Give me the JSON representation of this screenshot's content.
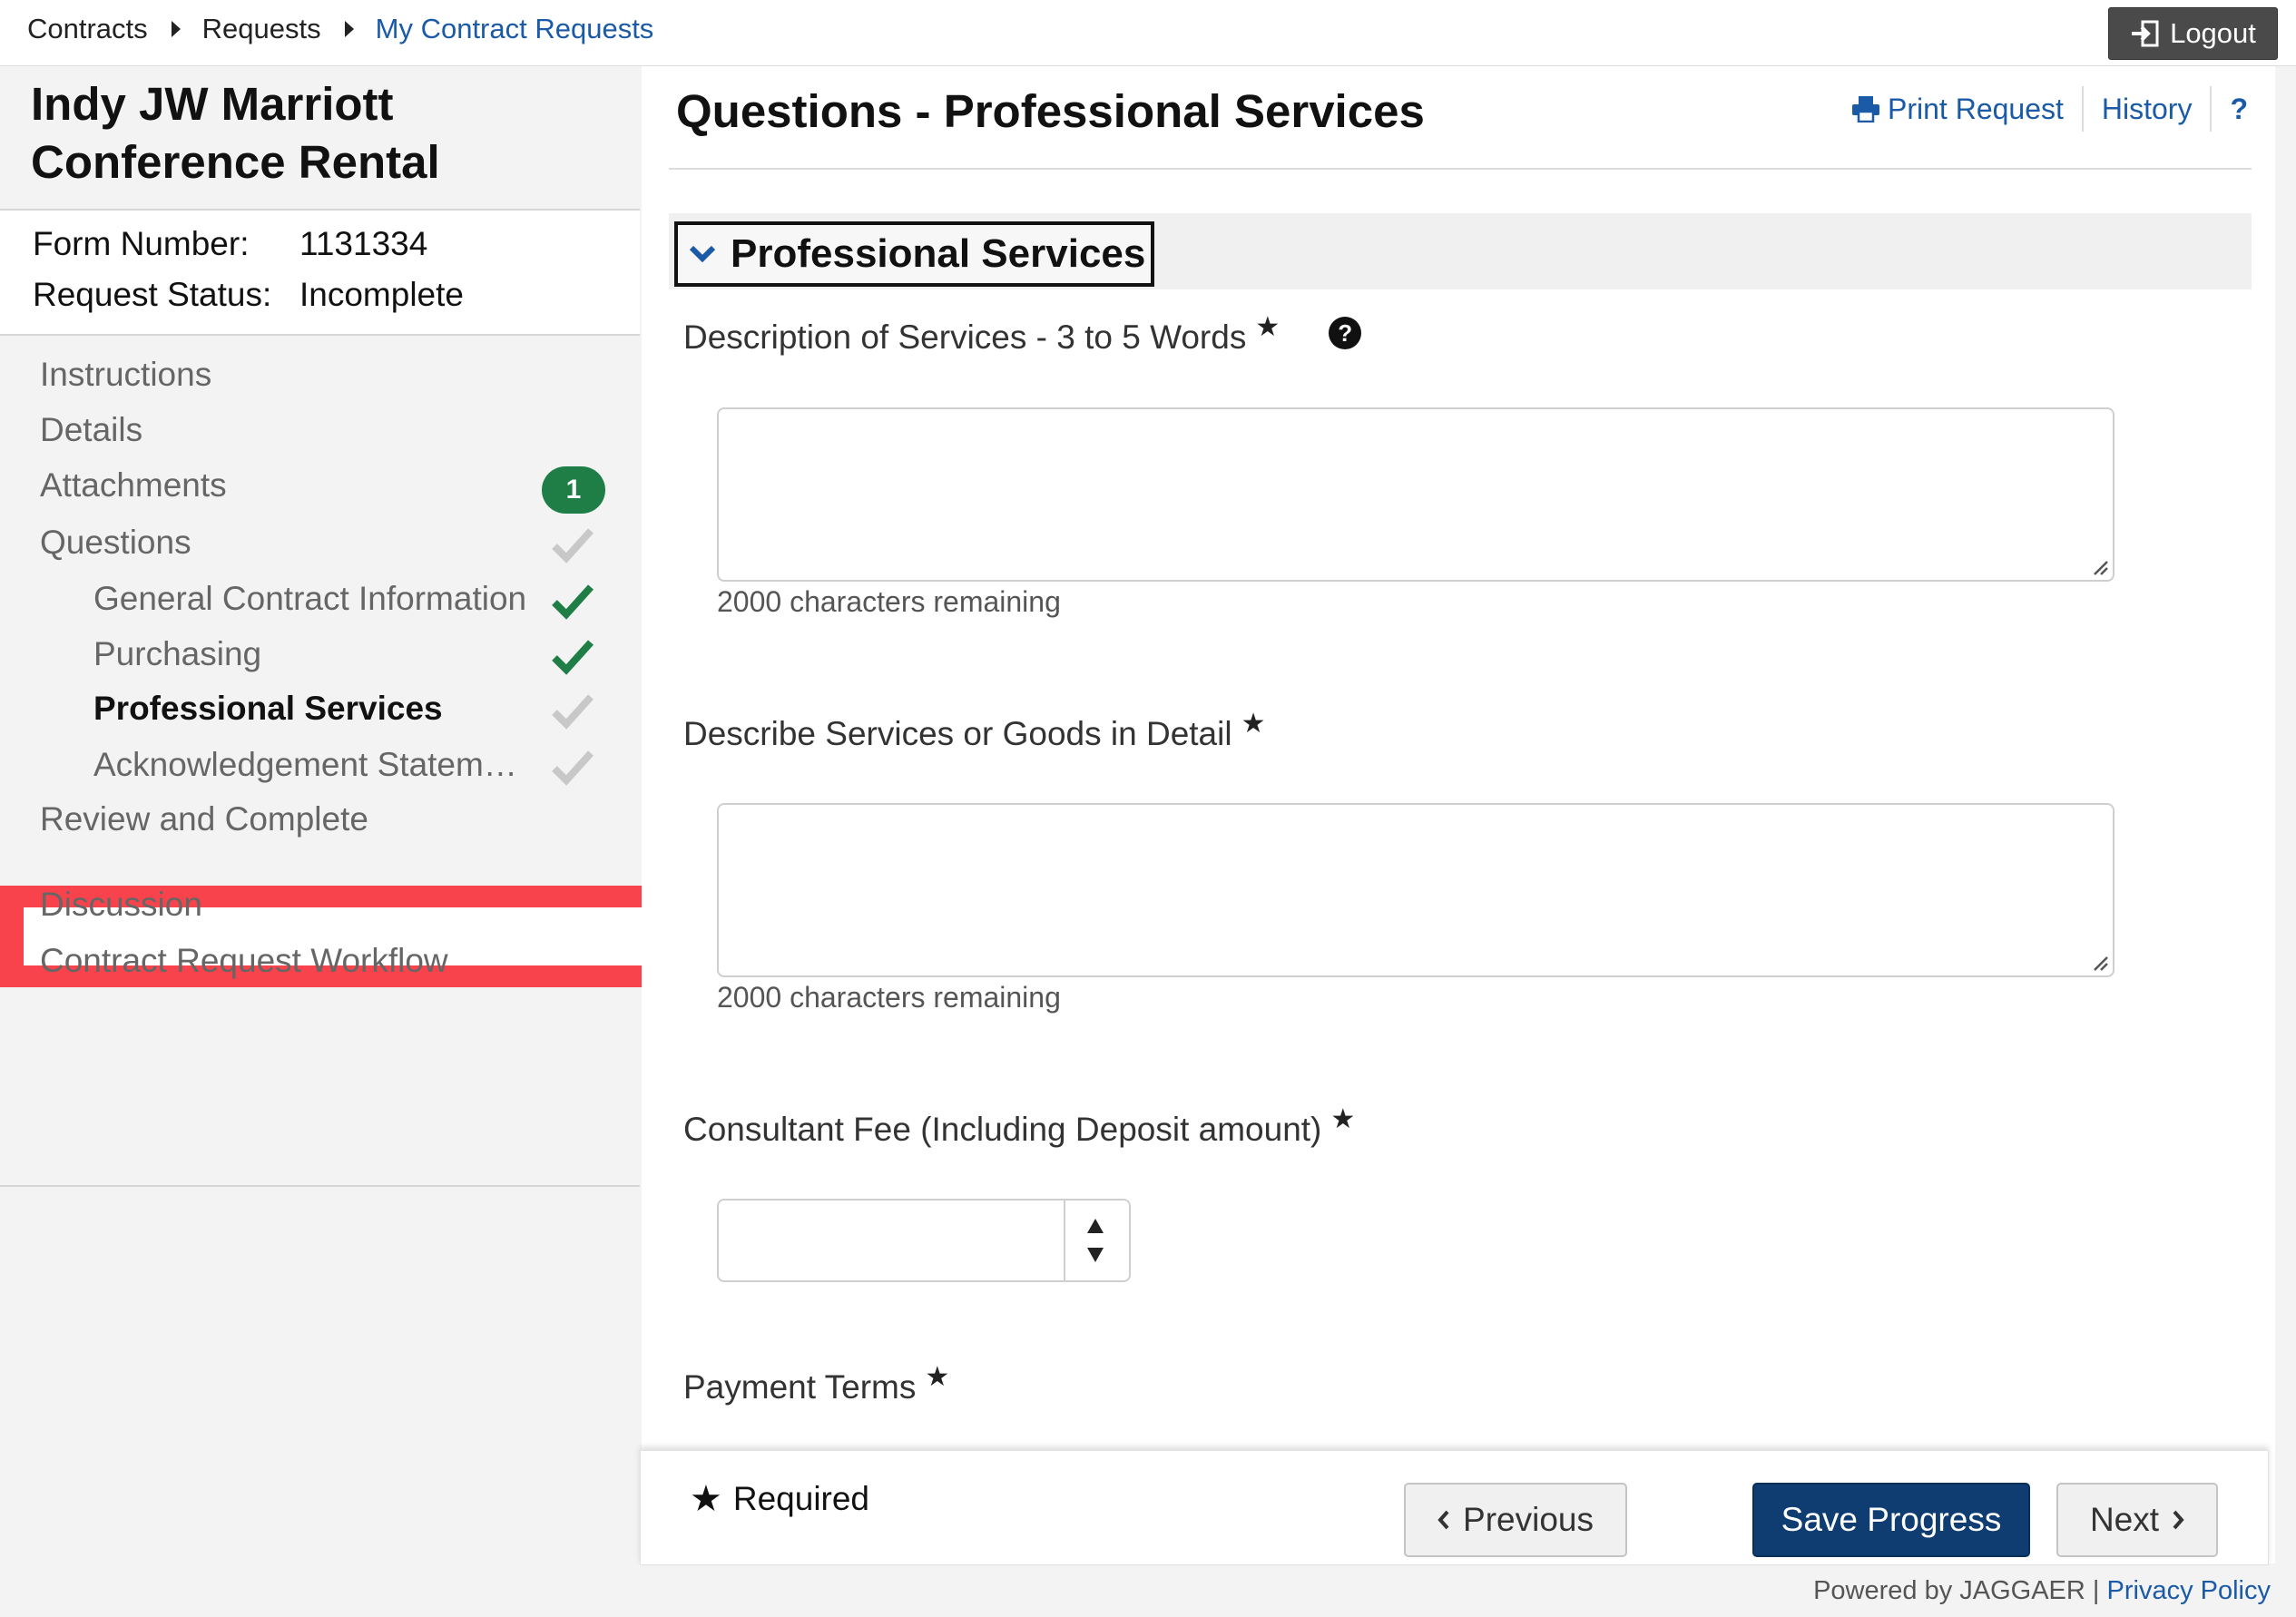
{
  "breadcrumb": {
    "items": [
      {
        "label": "Contracts"
      },
      {
        "label": "Requests"
      },
      {
        "label": "My Contract Requests"
      }
    ]
  },
  "header": {
    "logout_label": "Logout"
  },
  "sidebar": {
    "title_line1": "Indy JW Marriott",
    "title_line2": "Conference Rental",
    "form_number_label": "Form Number:",
    "form_number_value": "1131334",
    "status_label": "Request Status:",
    "status_value": "Incomplete",
    "nav": [
      {
        "label": "Instructions"
      },
      {
        "label": "Details"
      },
      {
        "label": "Attachments",
        "badge": "1"
      },
      {
        "label": "Questions",
        "status": "incomplete"
      },
      {
        "label": "General Contract Information",
        "status": "complete"
      },
      {
        "label": "Purchasing",
        "status": "complete"
      },
      {
        "label": "Professional Services",
        "status": "incomplete",
        "active": true
      },
      {
        "label": "Acknowledgement Statement",
        "status": "incomplete"
      },
      {
        "label": "Review and Complete"
      },
      {
        "label": "Discussion"
      },
      {
        "label": "Contract Request Workflow"
      }
    ]
  },
  "main": {
    "title": "Questions - Professional Services",
    "actions": {
      "print": "Print Request",
      "history": "History",
      "help": "?"
    },
    "section_title": "Professional Services",
    "questions": [
      {
        "label": "Description of Services - 3 to 5 Words",
        "required": true,
        "value": "",
        "remaining": "2000 characters remaining"
      },
      {
        "label": "Describe Services or Goods in Detail",
        "required": true,
        "value": "",
        "remaining": "2000 characters remaining"
      },
      {
        "label": "Consultant Fee (Including Deposit amount)",
        "required": true,
        "value": ""
      },
      {
        "label": "Payment Terms",
        "required": true
      }
    ]
  },
  "footer": {
    "required_label": "Required",
    "previous_label": "Previous",
    "save_label": "Save Progress",
    "next_label": "Next",
    "powered_by": "Powered by JAGGAER |",
    "privacy_label": "Privacy Policy"
  },
  "colors": {
    "brand_blue": "#0f3d72",
    "link_blue": "#1a5aa6",
    "check_green": "#1e7e46",
    "check_gray": "#c8c8c8",
    "highlight_red": "#f8434c"
  }
}
